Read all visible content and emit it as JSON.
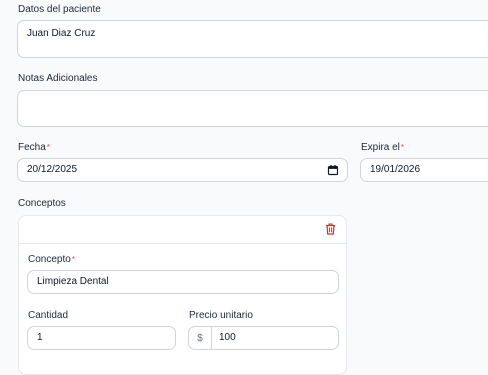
{
  "patient": {
    "label": "Datos del paciente",
    "value": "Juan Diaz Cruz"
  },
  "notes": {
    "label": "Notas Adicionales",
    "value": ""
  },
  "date": {
    "label": "Fecha",
    "required_mark": "*",
    "value": "20/12/2025"
  },
  "expires": {
    "label": "Expira el",
    "required_mark": "*",
    "value": "19/01/2026"
  },
  "concepts": {
    "label": "Conceptos",
    "items": [
      {
        "concept_label": "Concepto",
        "concept_required_mark": "*",
        "concept_value": "Limpieza Dental",
        "quantity_label": "Cantidad",
        "quantity_value": "1",
        "unit_price_label": "Precio unitario",
        "currency_prefix": "$",
        "unit_price_value": "100"
      }
    ]
  },
  "colors": {
    "accent_required": "#ef4444",
    "delete_icon": "#dc2626",
    "border": "#d1d5db",
    "background": "#f9fafb"
  },
  "icons": {
    "date_picker": "calendar-icon",
    "delete_concept": "trash-icon"
  }
}
